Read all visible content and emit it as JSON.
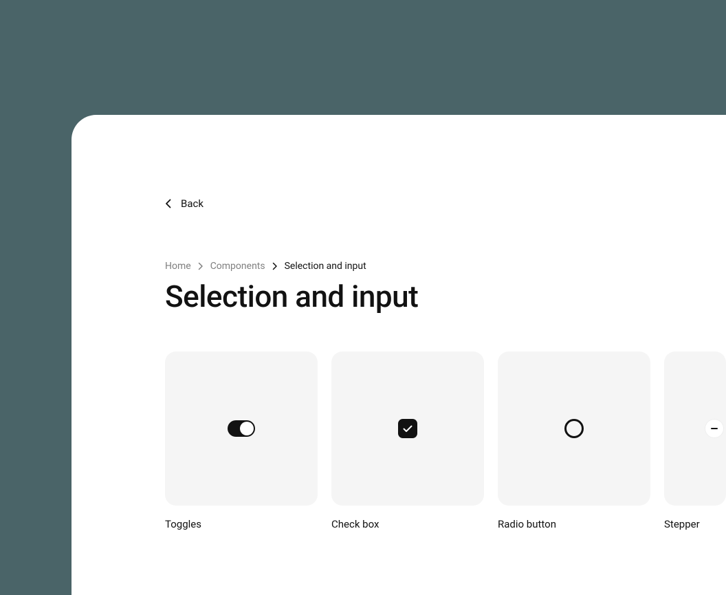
{
  "nav": {
    "back_label": "Back"
  },
  "breadcrumb": {
    "items": [
      {
        "label": "Home"
      },
      {
        "label": "Components"
      },
      {
        "label": "Selection and input"
      }
    ]
  },
  "page": {
    "title": "Selection and input"
  },
  "cards": [
    {
      "label": "Toggles"
    },
    {
      "label": "Check box"
    },
    {
      "label": "Radio button"
    },
    {
      "label": "Stepper"
    }
  ]
}
